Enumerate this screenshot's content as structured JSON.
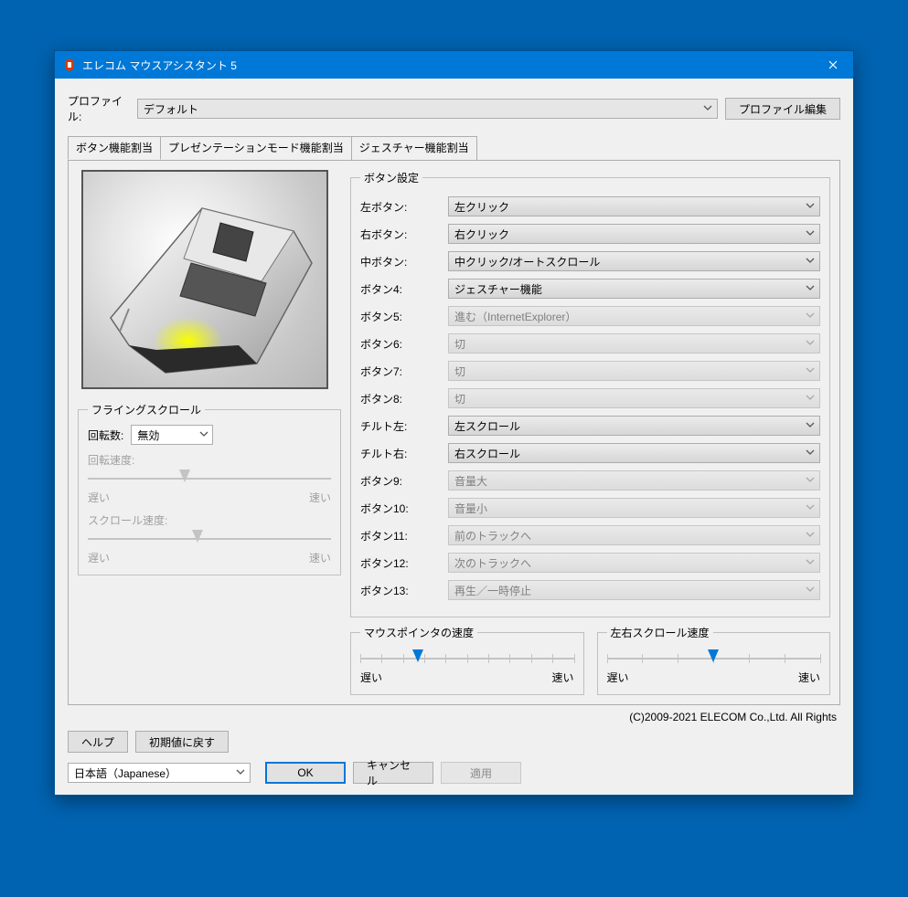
{
  "window": {
    "title": "エレコム マウスアシスタント 5"
  },
  "profile": {
    "label": "プロファイル:",
    "value": "デフォルト",
    "edit_btn": "プロファイル編集"
  },
  "tabs": {
    "t1": "ボタン機能割当",
    "t2": "プレゼンテーションモード機能割当",
    "t3": "ジェスチャー機能割当"
  },
  "flying": {
    "legend": "フライングスクロール",
    "rot_label": "回転数:",
    "rot_value": "無効",
    "rot_speed_label": "回転速度:",
    "scroll_speed_label": "スクロール速度:",
    "slow": "遅い",
    "fast": "速い"
  },
  "button_settings": {
    "legend": "ボタン設定",
    "rows": [
      {
        "label": "左ボタン:",
        "value": "左クリック",
        "enabled": true
      },
      {
        "label": "右ボタン:",
        "value": "右クリック",
        "enabled": true
      },
      {
        "label": "中ボタン:",
        "value": "中クリック/オートスクロール",
        "enabled": true
      },
      {
        "label": "ボタン4:",
        "value": "ジェスチャー機能",
        "enabled": true
      },
      {
        "label": "ボタン5:",
        "value": "進む（InternetExplorer）",
        "enabled": false
      },
      {
        "label": "ボタン6:",
        "value": "切",
        "enabled": false
      },
      {
        "label": "ボタン7:",
        "value": "切",
        "enabled": false
      },
      {
        "label": "ボタン8:",
        "value": "切",
        "enabled": false
      },
      {
        "label": "チルト左:",
        "value": "左スクロール",
        "enabled": true
      },
      {
        "label": "チルト右:",
        "value": "右スクロール",
        "enabled": true
      },
      {
        "label": "ボタン9:",
        "value": "音量大",
        "enabled": false
      },
      {
        "label": "ボタン10:",
        "value": "音量小",
        "enabled": false
      },
      {
        "label": "ボタン11:",
        "value": "前のトラックへ",
        "enabled": false
      },
      {
        "label": "ボタン12:",
        "value": "次のトラックへ",
        "enabled": false
      },
      {
        "label": "ボタン13:",
        "value": "再生／一時停止",
        "enabled": false
      }
    ]
  },
  "pointer_speed": {
    "legend": "マウスポインタの速度",
    "slow": "遅い",
    "fast": "速い"
  },
  "hscroll_speed": {
    "legend": "左右スクロール速度",
    "slow": "遅い",
    "fast": "速い"
  },
  "copyright": "(C)2009-2021 ELECOM Co.,Ltd. All Rights",
  "footer": {
    "help": "ヘルプ",
    "reset": "初期値に戻す",
    "ok": "OK",
    "cancel": "キャンセル",
    "apply": "適用"
  },
  "lang": "日本語（Japanese）"
}
